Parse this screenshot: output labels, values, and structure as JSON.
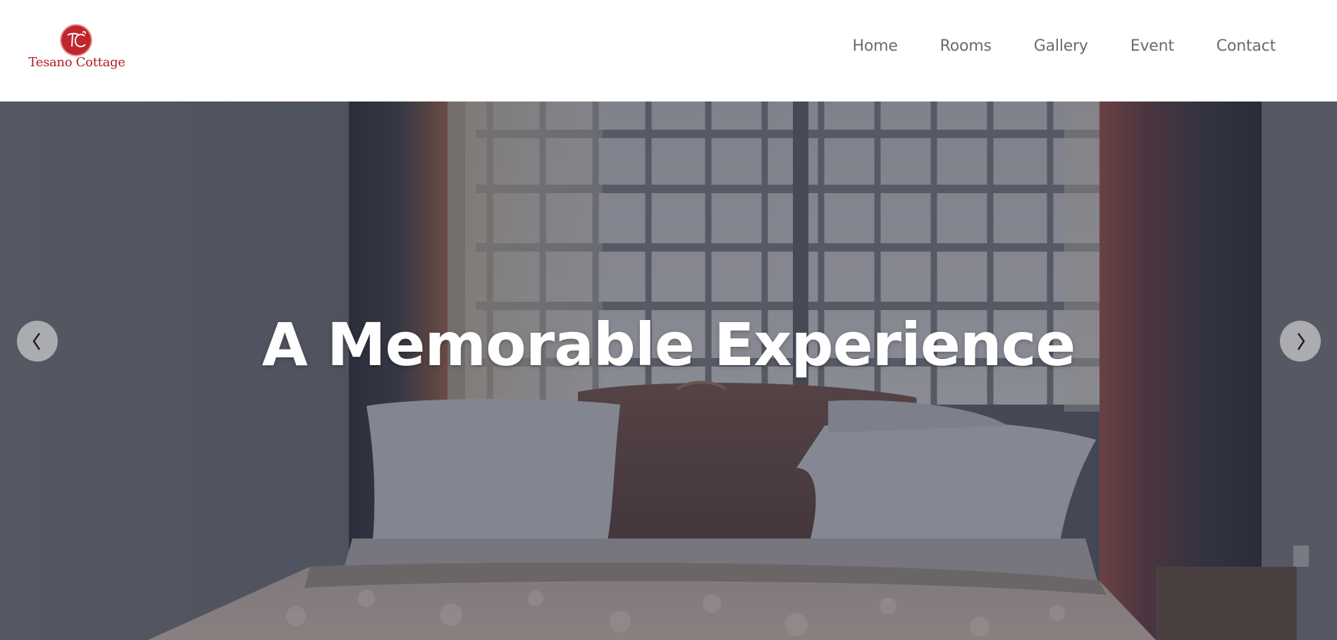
{
  "brand": {
    "name": "Tesano Cottage",
    "initials": "TC",
    "color": "#c0272d"
  },
  "nav": {
    "items": [
      {
        "label": "Home"
      },
      {
        "label": "Rooms"
      },
      {
        "label": "Gallery"
      },
      {
        "label": "Event"
      },
      {
        "label": "Contact"
      }
    ]
  },
  "hero": {
    "title": "A Memorable Experience",
    "image": "bedroom-photo",
    "prev_icon": "chevron-left-icon",
    "next_icon": "chevron-right-icon"
  }
}
